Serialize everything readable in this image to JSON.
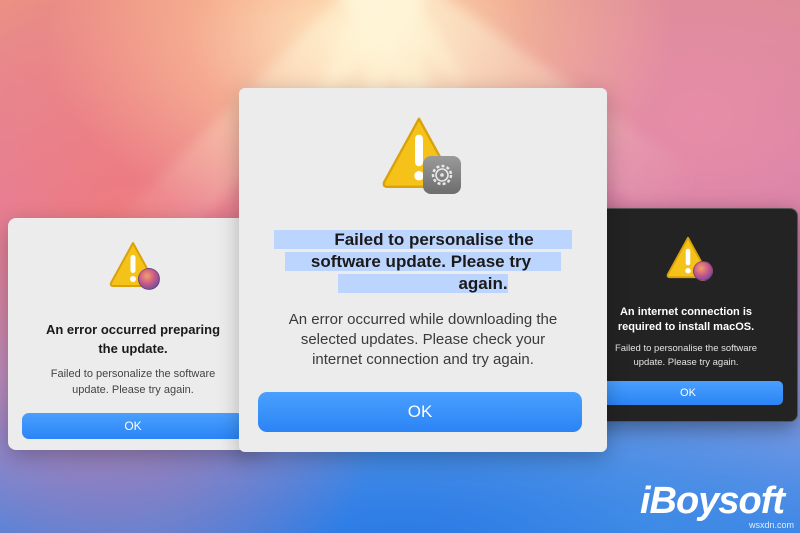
{
  "background": {
    "colors": {
      "accent_blue": "#2b84f5",
      "dialog_light": "#ececec",
      "dialog_dark": "#232323"
    }
  },
  "dialogs": {
    "left": {
      "icon": "warning-icon",
      "badge": "globe-installer-icon",
      "title_line1": "An error occurred preparing",
      "title_line2": "the update.",
      "message_line1": "Failed to personalize the software",
      "message_line2": "update. Please try again.",
      "ok_label": "OK"
    },
    "center": {
      "icon": "warning-icon",
      "badge": "gear-icon",
      "title_line1": "Failed to personalise the",
      "title_line2": "software update. Please try",
      "title_line3": "again.",
      "message_line1": "An error occurred while downloading the",
      "message_line2": "selected updates. Please check your",
      "message_line3": "internet connection and try again.",
      "ok_label": "OK"
    },
    "right": {
      "icon": "warning-icon",
      "badge": "globe-installer-icon",
      "title_line1": "An internet connection is",
      "title_line2": "required to install macOS.",
      "message_line1": "Failed to personalise the software",
      "message_line2": "update. Please try again.",
      "ok_label": "OK"
    }
  },
  "branding": {
    "logo_text": "iBoysoft",
    "watermark": "wsxdn.com"
  }
}
